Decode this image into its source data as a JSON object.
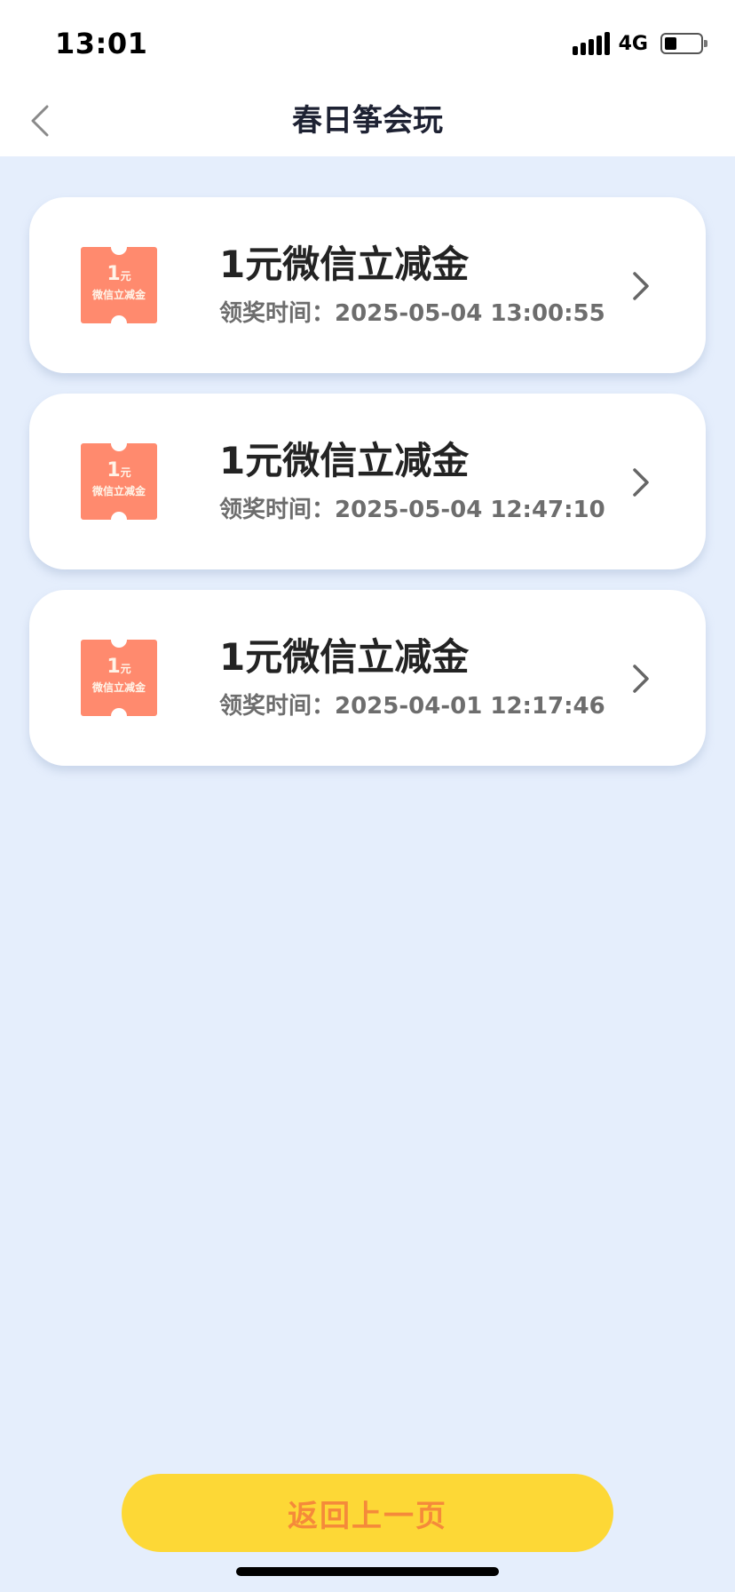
{
  "status_bar": {
    "time": "13:01",
    "network": "4G",
    "icons": [
      "signal-icon",
      "battery-icon"
    ]
  },
  "nav": {
    "title": "春日筝会玩",
    "back_icon": "chevron-left-icon"
  },
  "prizes": [
    {
      "ticket_amount": "1",
      "ticket_unit": "元",
      "ticket_name": "微信立减金",
      "title": "1元微信立减金",
      "time": "领奖时间：2025-05-04  13:00:55"
    },
    {
      "ticket_amount": "1",
      "ticket_unit": "元",
      "ticket_name": "微信立减金",
      "title": "1元微信立减金",
      "time": "领奖时间：2025-05-04  12:47:10"
    },
    {
      "ticket_amount": "1",
      "ticket_unit": "元",
      "ticket_name": "微信立减金",
      "title": "1元微信立减金",
      "time": "领奖时间：2025-04-01  12:17:46"
    }
  ],
  "footer": {
    "back_label": "返回上一页"
  },
  "colors": {
    "background": "#e5eefc",
    "card": "#ffffff",
    "ticket": "#ff8a6e",
    "button": "#fdd836",
    "button_text": "#f58a3a"
  }
}
